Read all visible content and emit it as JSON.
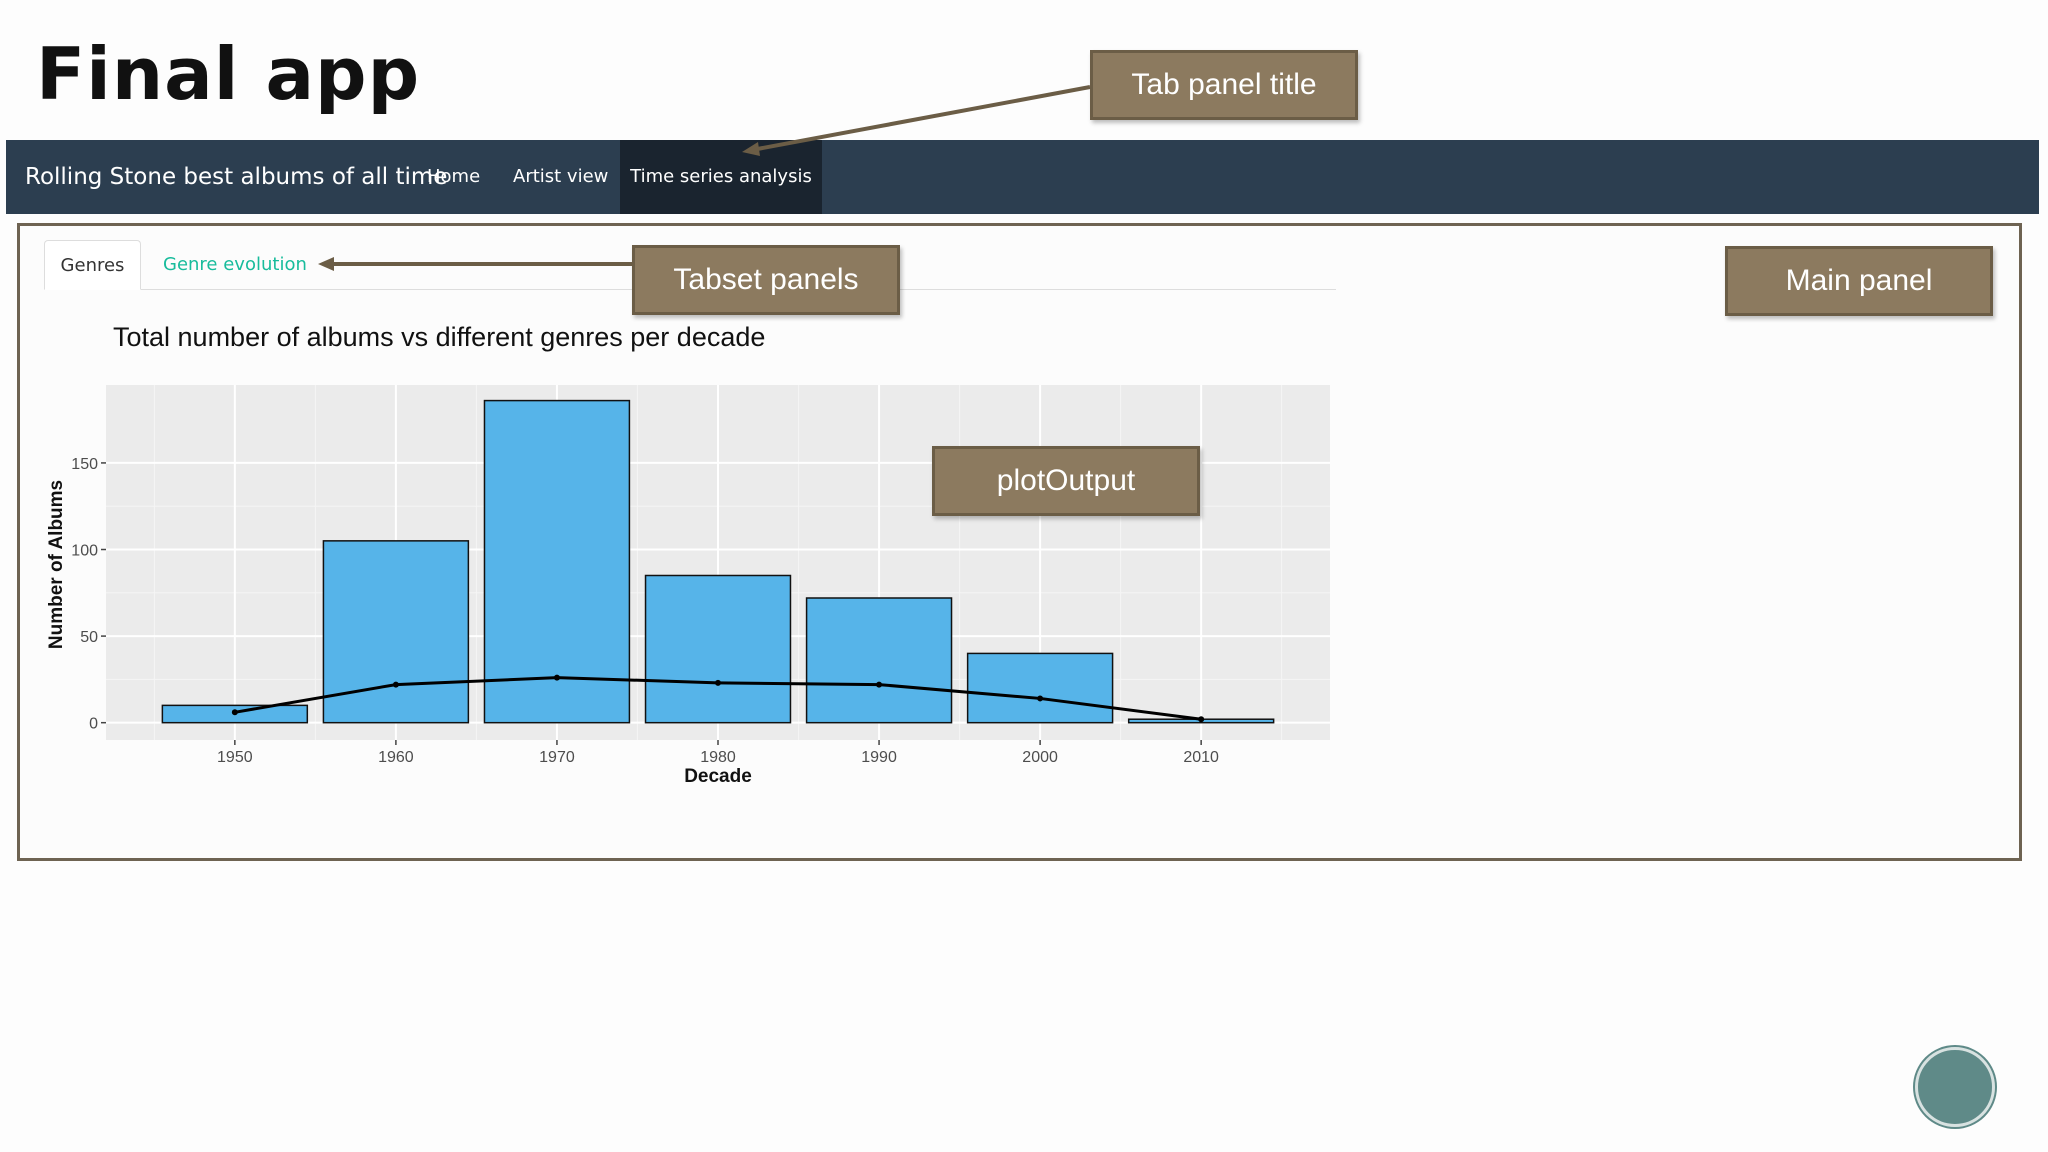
{
  "slide": {
    "title": "Final app"
  },
  "navbar": {
    "brand": "Rolling Stone best albums of all time",
    "items": [
      {
        "label": "Home"
      },
      {
        "label": "Artist view"
      },
      {
        "label": "Time series analysis",
        "active": true
      }
    ],
    "background": "#2c3e50",
    "active_background": "#1a242f"
  },
  "tabs": [
    {
      "label": "Genres",
      "active": true
    },
    {
      "label": "Genre evolution"
    }
  ],
  "callouts": {
    "tab_panel_title": "Tab panel title",
    "tabset_panels": "Tabset panels",
    "main_panel": "Main panel",
    "plot_output": "plotOutput"
  },
  "colors": {
    "callout_fill": "#8c7a5f",
    "bar_fill": "#56b4e9",
    "plot_bg": "#ebebeb",
    "tab_link": "#18bc9c"
  },
  "chart_data": {
    "type": "bar",
    "title": "Total number of albums vs different genres per decade",
    "xlabel": "Decade",
    "ylabel": "Number of Albums",
    "categories": [
      "1950",
      "1960",
      "1970",
      "1980",
      "1990",
      "2000",
      "2010"
    ],
    "values": [
      10,
      105,
      186,
      85,
      72,
      40,
      2
    ],
    "line_series": {
      "values": [
        6,
        22,
        26,
        23,
        22,
        14,
        2
      ]
    },
    "ylim": [
      -10,
      195
    ],
    "yticks": [
      0,
      50,
      100,
      150
    ],
    "grid": true
  }
}
